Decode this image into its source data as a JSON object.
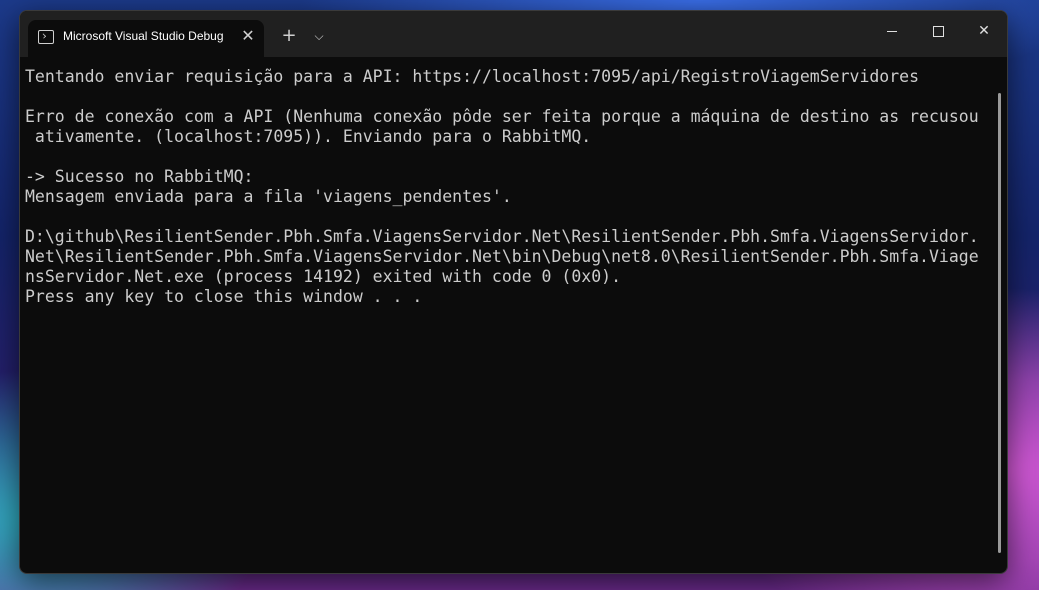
{
  "tab": {
    "title": "Microsoft Visual Studio Debug Console",
    "close": "✕"
  },
  "titlebar": {
    "new_tab": "+",
    "dropdown": "⌵",
    "close": "✕"
  },
  "console": {
    "lines": [
      "Tentando enviar requisição para a API: https://localhost:7095/api/RegistroViagemServidores",
      "",
      "Erro de conexão com a API (Nenhuma conexão pôde ser feita porque a máquina de destino as recusou",
      " ativamente. (localhost:7095)). Enviando para o RabbitMQ.",
      "",
      "-> Sucesso no RabbitMQ:",
      "Mensagem enviada para a fila 'viagens_pendentes'.",
      "",
      "D:\\github\\ResilientSender.Pbh.Smfa.ViagensServidor.Net\\ResilientSender.Pbh.Smfa.ViagensServidor.",
      "Net\\ResilientSender.Pbh.Smfa.ViagensServidor.Net\\bin\\Debug\\net8.0\\ResilientSender.Pbh.Smfa.Viage",
      "nsServidor.Net.exe (process 14192) exited with code 0 (0x0).",
      "Press any key to close this window . . ."
    ]
  }
}
